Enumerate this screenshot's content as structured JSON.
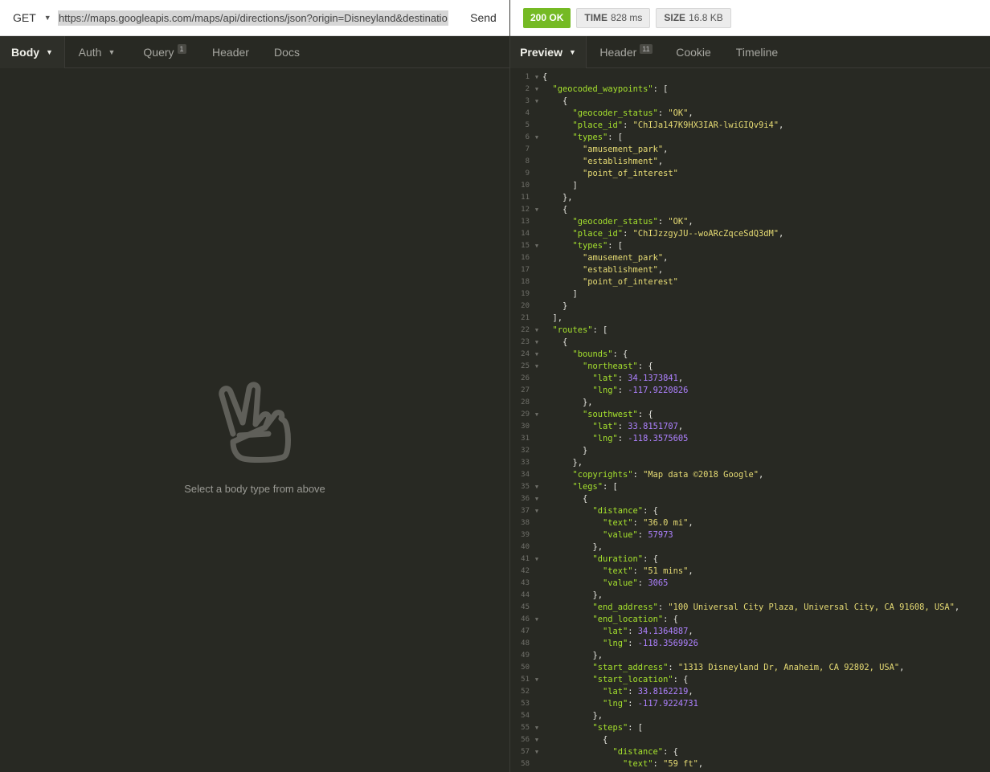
{
  "request": {
    "method": "GET",
    "url": "https://maps.googleapis.com/maps/api/directions/json?origin=Disneyland&destinatio",
    "send_label": "Send"
  },
  "left_tabs": [
    {
      "label": "Body",
      "active": true,
      "caret": true
    },
    {
      "label": "Auth",
      "active": false,
      "caret": true
    },
    {
      "label": "Query",
      "active": false,
      "badge": "1"
    },
    {
      "label": "Header",
      "active": false
    },
    {
      "label": "Docs",
      "active": false
    }
  ],
  "empty_state": {
    "icon": "peace-hand-icon",
    "message": "Select a body type from above"
  },
  "response": {
    "status": "200 OK",
    "time_label": "TIME",
    "time_value": "828 ms",
    "size_label": "SIZE",
    "size_value": "16.8 KB"
  },
  "right_tabs": [
    {
      "label": "Preview",
      "active": true,
      "caret": true
    },
    {
      "label": "Header",
      "active": false,
      "badge": "11"
    },
    {
      "label": "Cookie",
      "active": false
    },
    {
      "label": "Timeline",
      "active": false
    }
  ],
  "colors": {
    "key": "#a6e22e",
    "string": "#e6db74",
    "number": "#ae81ff",
    "status_ok": "#75ba24",
    "background": "#282923"
  },
  "code_lines": [
    {
      "n": "1",
      "f": true,
      "d": 0,
      "t": [
        [
          "p",
          "{"
        ]
      ]
    },
    {
      "n": "2",
      "f": true,
      "d": 1,
      "t": [
        [
          "k",
          "\"geocoded_waypoints\""
        ],
        [
          "p",
          ": ["
        ]
      ]
    },
    {
      "n": "3",
      "f": true,
      "d": 2,
      "t": [
        [
          "p",
          "{"
        ]
      ]
    },
    {
      "n": "4",
      "f": false,
      "d": 3,
      "t": [
        [
          "k",
          "\"geocoder_status\""
        ],
        [
          "p",
          ": "
        ],
        [
          "s",
          "\"OK\""
        ],
        [
          "p",
          ","
        ]
      ]
    },
    {
      "n": "5",
      "f": false,
      "d": 3,
      "t": [
        [
          "k",
          "\"place_id\""
        ],
        [
          "p",
          ": "
        ],
        [
          "s",
          "\"ChIJa147K9HX3IAR-lwiGIQv9i4\""
        ],
        [
          "p",
          ","
        ]
      ]
    },
    {
      "n": "6",
      "f": true,
      "d": 3,
      "t": [
        [
          "k",
          "\"types\""
        ],
        [
          "p",
          ": ["
        ]
      ]
    },
    {
      "n": "7",
      "f": false,
      "d": 4,
      "t": [
        [
          "s",
          "\"amusement_park\""
        ],
        [
          "p",
          ","
        ]
      ]
    },
    {
      "n": "8",
      "f": false,
      "d": 4,
      "t": [
        [
          "s",
          "\"establishment\""
        ],
        [
          "p",
          ","
        ]
      ]
    },
    {
      "n": "9",
      "f": false,
      "d": 4,
      "t": [
        [
          "s",
          "\"point_of_interest\""
        ]
      ]
    },
    {
      "n": "10",
      "f": false,
      "d": 3,
      "t": [
        [
          "p",
          "]"
        ]
      ]
    },
    {
      "n": "11",
      "f": false,
      "d": 2,
      "t": [
        [
          "p",
          "},"
        ]
      ]
    },
    {
      "n": "12",
      "f": true,
      "d": 2,
      "t": [
        [
          "p",
          "{"
        ]
      ]
    },
    {
      "n": "13",
      "f": false,
      "d": 3,
      "t": [
        [
          "k",
          "\"geocoder_status\""
        ],
        [
          "p",
          ": "
        ],
        [
          "s",
          "\"OK\""
        ],
        [
          "p",
          ","
        ]
      ]
    },
    {
      "n": "14",
      "f": false,
      "d": 3,
      "t": [
        [
          "k",
          "\"place_id\""
        ],
        [
          "p",
          ": "
        ],
        [
          "s",
          "\"ChIJzzgyJU--woARcZqceSdQ3dM\""
        ],
        [
          "p",
          ","
        ]
      ]
    },
    {
      "n": "15",
      "f": true,
      "d": 3,
      "t": [
        [
          "k",
          "\"types\""
        ],
        [
          "p",
          ": ["
        ]
      ]
    },
    {
      "n": "16",
      "f": false,
      "d": 4,
      "t": [
        [
          "s",
          "\"amusement_park\""
        ],
        [
          "p",
          ","
        ]
      ]
    },
    {
      "n": "17",
      "f": false,
      "d": 4,
      "t": [
        [
          "s",
          "\"establishment\""
        ],
        [
          "p",
          ","
        ]
      ]
    },
    {
      "n": "18",
      "f": false,
      "d": 4,
      "t": [
        [
          "s",
          "\"point_of_interest\""
        ]
      ]
    },
    {
      "n": "19",
      "f": false,
      "d": 3,
      "t": [
        [
          "p",
          "]"
        ]
      ]
    },
    {
      "n": "20",
      "f": false,
      "d": 2,
      "t": [
        [
          "p",
          "}"
        ]
      ]
    },
    {
      "n": "21",
      "f": false,
      "d": 1,
      "t": [
        [
          "p",
          "],"
        ]
      ]
    },
    {
      "n": "22",
      "f": true,
      "d": 1,
      "t": [
        [
          "k",
          "\"routes\""
        ],
        [
          "p",
          ": ["
        ]
      ]
    },
    {
      "n": "23",
      "f": true,
      "d": 2,
      "t": [
        [
          "p",
          "{"
        ]
      ]
    },
    {
      "n": "24",
      "f": true,
      "d": 3,
      "t": [
        [
          "k",
          "\"bounds\""
        ],
        [
          "p",
          ": {"
        ]
      ]
    },
    {
      "n": "25",
      "f": true,
      "d": 4,
      "t": [
        [
          "k",
          "\"northeast\""
        ],
        [
          "p",
          ": {"
        ]
      ]
    },
    {
      "n": "26",
      "f": false,
      "d": 5,
      "t": [
        [
          "k",
          "\"lat\""
        ],
        [
          "p",
          ": "
        ],
        [
          "n",
          "34.1373841"
        ],
        [
          "p",
          ","
        ]
      ]
    },
    {
      "n": "27",
      "f": false,
      "d": 5,
      "t": [
        [
          "k",
          "\"lng\""
        ],
        [
          "p",
          ": "
        ],
        [
          "n",
          "-117.9220826"
        ]
      ]
    },
    {
      "n": "28",
      "f": false,
      "d": 4,
      "t": [
        [
          "p",
          "},"
        ]
      ]
    },
    {
      "n": "29",
      "f": true,
      "d": 4,
      "t": [
        [
          "k",
          "\"southwest\""
        ],
        [
          "p",
          ": {"
        ]
      ]
    },
    {
      "n": "30",
      "f": false,
      "d": 5,
      "t": [
        [
          "k",
          "\"lat\""
        ],
        [
          "p",
          ": "
        ],
        [
          "n",
          "33.8151707"
        ],
        [
          "p",
          ","
        ]
      ]
    },
    {
      "n": "31",
      "f": false,
      "d": 5,
      "t": [
        [
          "k",
          "\"lng\""
        ],
        [
          "p",
          ": "
        ],
        [
          "n",
          "-118.3575605"
        ]
      ]
    },
    {
      "n": "32",
      "f": false,
      "d": 4,
      "t": [
        [
          "p",
          "}"
        ]
      ]
    },
    {
      "n": "33",
      "f": false,
      "d": 3,
      "t": [
        [
          "p",
          "},"
        ]
      ]
    },
    {
      "n": "34",
      "f": false,
      "d": 3,
      "t": [
        [
          "k",
          "\"copyrights\""
        ],
        [
          "p",
          ": "
        ],
        [
          "s",
          "\"Map data ©2018 Google\""
        ],
        [
          "p",
          ","
        ]
      ]
    },
    {
      "n": "35",
      "f": true,
      "d": 3,
      "t": [
        [
          "k",
          "\"legs\""
        ],
        [
          "p",
          ": ["
        ]
      ]
    },
    {
      "n": "36",
      "f": true,
      "d": 4,
      "t": [
        [
          "p",
          "{"
        ]
      ]
    },
    {
      "n": "37",
      "f": true,
      "d": 5,
      "t": [
        [
          "k",
          "\"distance\""
        ],
        [
          "p",
          ": {"
        ]
      ]
    },
    {
      "n": "38",
      "f": false,
      "d": 6,
      "t": [
        [
          "k",
          "\"text\""
        ],
        [
          "p",
          ": "
        ],
        [
          "s",
          "\"36.0 mi\""
        ],
        [
          "p",
          ","
        ]
      ]
    },
    {
      "n": "39",
      "f": false,
      "d": 6,
      "t": [
        [
          "k",
          "\"value\""
        ],
        [
          "p",
          ": "
        ],
        [
          "n",
          "57973"
        ]
      ]
    },
    {
      "n": "40",
      "f": false,
      "d": 5,
      "t": [
        [
          "p",
          "},"
        ]
      ]
    },
    {
      "n": "41",
      "f": true,
      "d": 5,
      "t": [
        [
          "k",
          "\"duration\""
        ],
        [
          "p",
          ": {"
        ]
      ]
    },
    {
      "n": "42",
      "f": false,
      "d": 6,
      "t": [
        [
          "k",
          "\"text\""
        ],
        [
          "p",
          ": "
        ],
        [
          "s",
          "\"51 mins\""
        ],
        [
          "p",
          ","
        ]
      ]
    },
    {
      "n": "43",
      "f": false,
      "d": 6,
      "t": [
        [
          "k",
          "\"value\""
        ],
        [
          "p",
          ": "
        ],
        [
          "n",
          "3065"
        ]
      ]
    },
    {
      "n": "44",
      "f": false,
      "d": 5,
      "t": [
        [
          "p",
          "},"
        ]
      ]
    },
    {
      "n": "45",
      "f": false,
      "d": 5,
      "t": [
        [
          "k",
          "\"end_address\""
        ],
        [
          "p",
          ": "
        ],
        [
          "s",
          "\"100 Universal City Plaza, Universal City, CA 91608, USA\""
        ],
        [
          "p",
          ","
        ]
      ]
    },
    {
      "n": "46",
      "f": true,
      "d": 5,
      "t": [
        [
          "k",
          "\"end_location\""
        ],
        [
          "p",
          ": {"
        ]
      ]
    },
    {
      "n": "47",
      "f": false,
      "d": 6,
      "t": [
        [
          "k",
          "\"lat\""
        ],
        [
          "p",
          ": "
        ],
        [
          "n",
          "34.1364887"
        ],
        [
          "p",
          ","
        ]
      ]
    },
    {
      "n": "48",
      "f": false,
      "d": 6,
      "t": [
        [
          "k",
          "\"lng\""
        ],
        [
          "p",
          ": "
        ],
        [
          "n",
          "-118.3569926"
        ]
      ]
    },
    {
      "n": "49",
      "f": false,
      "d": 5,
      "t": [
        [
          "p",
          "},"
        ]
      ]
    },
    {
      "n": "50",
      "f": false,
      "d": 5,
      "t": [
        [
          "k",
          "\"start_address\""
        ],
        [
          "p",
          ": "
        ],
        [
          "s",
          "\"1313 Disneyland Dr, Anaheim, CA 92802, USA\""
        ],
        [
          "p",
          ","
        ]
      ]
    },
    {
      "n": "51",
      "f": true,
      "d": 5,
      "t": [
        [
          "k",
          "\"start_location\""
        ],
        [
          "p",
          ": {"
        ]
      ]
    },
    {
      "n": "52",
      "f": false,
      "d": 6,
      "t": [
        [
          "k",
          "\"lat\""
        ],
        [
          "p",
          ": "
        ],
        [
          "n",
          "33.8162219"
        ],
        [
          "p",
          ","
        ]
      ]
    },
    {
      "n": "53",
      "f": false,
      "d": 6,
      "t": [
        [
          "k",
          "\"lng\""
        ],
        [
          "p",
          ": "
        ],
        [
          "n",
          "-117.9224731"
        ]
      ]
    },
    {
      "n": "54",
      "f": false,
      "d": 5,
      "t": [
        [
          "p",
          "},"
        ]
      ]
    },
    {
      "n": "55",
      "f": true,
      "d": 5,
      "t": [
        [
          "k",
          "\"steps\""
        ],
        [
          "p",
          ": ["
        ]
      ]
    },
    {
      "n": "56",
      "f": true,
      "d": 6,
      "t": [
        [
          "p",
          "{"
        ]
      ]
    },
    {
      "n": "57",
      "f": true,
      "d": 7,
      "t": [
        [
          "k",
          "\"distance\""
        ],
        [
          "p",
          ": {"
        ]
      ]
    },
    {
      "n": "58",
      "f": false,
      "d": 8,
      "t": [
        [
          "k",
          "\"text\""
        ],
        [
          "p",
          ": "
        ],
        [
          "s",
          "\"59 ft\""
        ],
        [
          "p",
          ","
        ]
      ]
    }
  ]
}
